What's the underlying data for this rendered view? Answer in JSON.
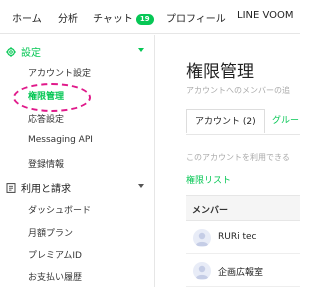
{
  "topnav": {
    "items": [
      {
        "label": "ホーム"
      },
      {
        "label": "分析"
      },
      {
        "label": "チャット",
        "badge": "19"
      },
      {
        "label": "プロフィール"
      },
      {
        "label": "LINE VOOM"
      }
    ]
  },
  "sidebar": {
    "sections": [
      {
        "label": "設定",
        "icon": "gear-icon",
        "items": [
          {
            "label": "アカウント設定"
          },
          {
            "label": "権限管理"
          },
          {
            "label": "応答設定"
          },
          {
            "label": "Messaging API"
          },
          {
            "label": "登録情報"
          }
        ]
      },
      {
        "label": "利用と請求",
        "icon": "receipt-icon",
        "items": [
          {
            "label": "ダッシュボード"
          },
          {
            "label": "月額プラン"
          },
          {
            "label": "プレミアムID"
          },
          {
            "label": "お支払い履歴"
          }
        ]
      }
    ]
  },
  "main": {
    "title": "権限管理",
    "subtitle": "アカウントへのメンバーの追",
    "tabs": [
      {
        "label": "アカウント (2)"
      },
      {
        "label": "グルー"
      }
    ],
    "note": "このアカウントを利用できる",
    "permission_list_link": "権限リスト",
    "table": {
      "header": "メンバー",
      "rows": [
        {
          "name": "RURi tec"
        },
        {
          "name": "企画広報室"
        }
      ]
    }
  },
  "colors": {
    "accent": "#06c755",
    "highlight": "#e0198a"
  }
}
